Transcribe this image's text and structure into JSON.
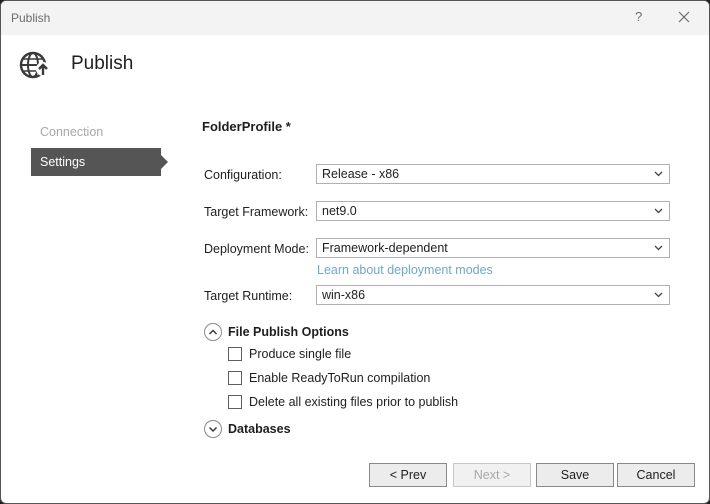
{
  "window": {
    "title": "Publish",
    "help_label": "?"
  },
  "header": {
    "title": "Publish"
  },
  "sidebar": {
    "items": [
      {
        "label": "Connection"
      },
      {
        "label": "Settings"
      }
    ]
  },
  "profile": {
    "title": "FolderProfile *"
  },
  "fields": {
    "configuration": {
      "label": "Configuration:",
      "value": "Release - x86"
    },
    "target_framework": {
      "label": "Target Framework:",
      "value": "net9.0"
    },
    "deployment_mode": {
      "label": "Deployment Mode:",
      "value": "Framework-dependent",
      "link": "Learn about deployment modes"
    },
    "target_runtime": {
      "label": "Target Runtime:",
      "value": "win-x86"
    }
  },
  "file_publish_options": {
    "title": "File Publish Options",
    "expanded": true,
    "options": [
      {
        "label": "Produce single file",
        "checked": false
      },
      {
        "label": "Enable ReadyToRun compilation",
        "checked": false
      },
      {
        "label": "Delete all existing files prior to publish",
        "checked": false
      }
    ]
  },
  "databases": {
    "title": "Databases",
    "expanded": false
  },
  "buttons": {
    "prev": "< Prev",
    "next": "Next >",
    "save": "Save",
    "cancel": "Cancel"
  },
  "colors": {
    "accent_nav": "#555555",
    "link": "#6fa8c8"
  },
  "icons": [
    "close-icon",
    "globe-publish-icon",
    "chevron-down-icon",
    "chevron-up-icon"
  ]
}
